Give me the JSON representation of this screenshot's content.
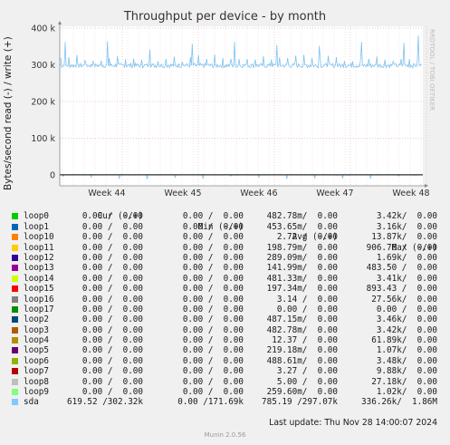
{
  "chart_data": {
    "type": "line",
    "title": "Throughput per device - by month",
    "ylabel": "Bytes/second read (-) / write (+)",
    "ylim": [
      -30000,
      405000
    ],
    "yticks": [
      {
        "value": 0,
        "label": "0"
      },
      {
        "value": 100000,
        "label": "100 k"
      },
      {
        "value": 200000,
        "label": "200 k"
      },
      {
        "value": 300000,
        "label": "300 k"
      },
      {
        "value": 400000,
        "label": "400 k"
      }
    ],
    "xticks": [
      "Week 44",
      "Week 45",
      "Week 46",
      "Week 47",
      "Week 48"
    ],
    "series": [
      {
        "name": "sda",
        "color": "#7ec3f0",
        "read_estimate": -3000,
        "write_baseline": 300000,
        "write_peak": 380000
      }
    ],
    "grid": true
  },
  "side_label": "RRDTOOL / TOBI OETIKER",
  "legend": {
    "headers": [
      "Cur (-/+)",
      "Min (-/+)",
      "Avg (-/+)",
      "Max (-/+)"
    ],
    "rows": [
      {
        "name": "loop0",
        "color": "#00cc00",
        "cur": "0.00 /  0.00",
        "min": "0.00 /  0.00",
        "avg": "482.78m/  0.00",
        "max": "3.42k/  0.00"
      },
      {
        "name": "loop1",
        "color": "#0066b3",
        "cur": "0.00 /  0.00",
        "min": "0.00 /  0.00",
        "avg": "453.65m/  0.00",
        "max": "3.16k/  0.00"
      },
      {
        "name": "loop10",
        "color": "#ff8000",
        "cur": "0.00 /  0.00",
        "min": "0.00 /  0.00",
        "avg": "2.72 /  0.00",
        "max": "13.87k/  0.00"
      },
      {
        "name": "loop11",
        "color": "#ffcc00",
        "cur": "0.00 /  0.00",
        "min": "0.00 /  0.00",
        "avg": "198.79m/  0.00",
        "max": "906.76 /  0.00"
      },
      {
        "name": "loop12",
        "color": "#330099",
        "cur": "0.00 /  0.00",
        "min": "0.00 /  0.00",
        "avg": "289.09m/  0.00",
        "max": "1.69k/  0.00"
      },
      {
        "name": "loop13",
        "color": "#990099",
        "cur": "0.00 /  0.00",
        "min": "0.00 /  0.00",
        "avg": "141.99m/  0.00",
        "max": "483.50 /  0.00"
      },
      {
        "name": "loop14",
        "color": "#ccff00",
        "cur": "0.00 /  0.00",
        "min": "0.00 /  0.00",
        "avg": "481.33m/  0.00",
        "max": "3.41k/  0.00"
      },
      {
        "name": "loop15",
        "color": "#ff0000",
        "cur": "0.00 /  0.00",
        "min": "0.00 /  0.00",
        "avg": "197.34m/  0.00",
        "max": "893.43 /  0.00"
      },
      {
        "name": "loop16",
        "color": "#808080",
        "cur": "0.00 /  0.00",
        "min": "0.00 /  0.00",
        "avg": "3.14 /  0.00",
        "max": "27.56k/  0.00"
      },
      {
        "name": "loop17",
        "color": "#008f00",
        "cur": "0.00 /  0.00",
        "min": "0.00 /  0.00",
        "avg": "0.00 /  0.00",
        "max": "0.00 /  0.00"
      },
      {
        "name": "loop2",
        "color": "#00487d",
        "cur": "0.00 /  0.00",
        "min": "0.00 /  0.00",
        "avg": "487.15m/  0.00",
        "max": "3.46k/  0.00"
      },
      {
        "name": "loop3",
        "color": "#b35a00",
        "cur": "0.00 /  0.00",
        "min": "0.00 /  0.00",
        "avg": "482.78m/  0.00",
        "max": "3.42k/  0.00"
      },
      {
        "name": "loop4",
        "color": "#b38f00",
        "cur": "0.00 /  0.00",
        "min": "0.00 /  0.00",
        "avg": "12.37 /  0.00",
        "max": "61.89k/  0.00"
      },
      {
        "name": "loop5",
        "color": "#6b006b",
        "cur": "0.00 /  0.00",
        "min": "0.00 /  0.00",
        "avg": "219.18m/  0.00",
        "max": "1.07k/  0.00"
      },
      {
        "name": "loop6",
        "color": "#8fb300",
        "cur": "0.00 /  0.00",
        "min": "0.00 /  0.00",
        "avg": "488.61m/  0.00",
        "max": "3.48k/  0.00"
      },
      {
        "name": "loop7",
        "color": "#b30000",
        "cur": "0.00 /  0.00",
        "min": "0.00 /  0.00",
        "avg": "3.27 /  0.00",
        "max": "9.88k/  0.00"
      },
      {
        "name": "loop8",
        "color": "#bebebe",
        "cur": "0.00 /  0.00",
        "min": "0.00 /  0.00",
        "avg": "5.00 /  0.00",
        "max": "27.18k/  0.00"
      },
      {
        "name": "loop9",
        "color": "#80ff80",
        "cur": "0.00 /  0.00",
        "min": "0.00 /  0.00",
        "avg": "259.60m/  0.00",
        "max": "1.02k/  0.00"
      },
      {
        "name": "sda",
        "color": "#80c9ff",
        "cur": "619.52 /302.32k",
        "min": "0.00 /171.69k",
        "avg": "785.19 /297.07k",
        "max": "336.26k/  1.86M"
      }
    ]
  },
  "footer": {
    "last_update": "Last update: Thu Nov 28 14:00:07 2024",
    "munin_version": "Munin 2.0.56"
  }
}
